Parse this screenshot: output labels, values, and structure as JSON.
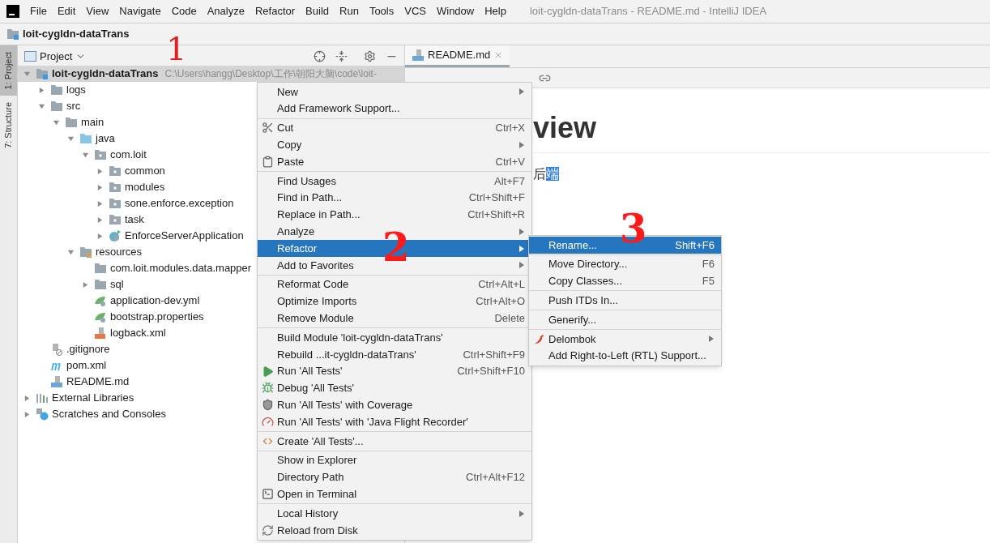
{
  "menu_bar": {
    "items": [
      "File",
      "Edit",
      "View",
      "Navigate",
      "Code",
      "Analyze",
      "Refactor",
      "Build",
      "Run",
      "Tools",
      "VCS",
      "Window",
      "Help"
    ],
    "title": "loit-cygldn-dataTrans - README.md - IntelliJ IDEA"
  },
  "nav_bar": {
    "project": "loit-cygldn-dataTrans"
  },
  "side_strip": [
    {
      "label": "1: Project",
      "selected": true
    },
    {
      "label": "7: Structure",
      "selected": false
    }
  ],
  "project_panel": {
    "title": "Project",
    "tree": [
      {
        "label": "loit-cygldn-dataTrans",
        "hint": "C:\\Users\\hangg\\Desktop\\工作\\朝阳大脑\\code\\loit-",
        "kind": "module",
        "expanded": true,
        "selected": true,
        "children": [
          {
            "label": "logs",
            "kind": "folder",
            "expanded": false
          },
          {
            "label": "src",
            "kind": "folder",
            "expanded": true,
            "children": [
              {
                "label": "main",
                "kind": "folder",
                "expanded": true,
                "children": [
                  {
                    "label": "java",
                    "kind": "source",
                    "expanded": true,
                    "children": [
                      {
                        "label": "com.loit",
                        "kind": "package",
                        "expanded": true,
                        "children": [
                          {
                            "label": "common",
                            "kind": "package",
                            "expanded": false
                          },
                          {
                            "label": "modules",
                            "kind": "package",
                            "expanded": false
                          },
                          {
                            "label": "sone.enforce.exception",
                            "kind": "package",
                            "expanded": false
                          },
                          {
                            "label": "task",
                            "kind": "package",
                            "expanded": false
                          },
                          {
                            "label": "EnforceServerApplication",
                            "kind": "springclass",
                            "expanded": false
                          }
                        ]
                      }
                    ]
                  },
                  {
                    "label": "resources",
                    "kind": "resources",
                    "expanded": true,
                    "children": [
                      {
                        "label": "com.loit.modules.data.mapper",
                        "kind": "folder"
                      },
                      {
                        "label": "sql",
                        "kind": "folder",
                        "expanded": false
                      },
                      {
                        "label": "application-dev.yml",
                        "kind": "springconfig"
                      },
                      {
                        "label": "bootstrap.properties",
                        "kind": "springconfig"
                      },
                      {
                        "label": "logback.xml",
                        "kind": "xml"
                      }
                    ]
                  }
                ]
              }
            ]
          },
          {
            "label": ".gitignore",
            "kind": "ignore"
          },
          {
            "label": "pom.xml",
            "kind": "maven"
          },
          {
            "label": "README.md",
            "kind": "markdown"
          }
        ]
      },
      {
        "label": "External Libraries",
        "kind": "libraries",
        "expanded": false
      },
      {
        "label": "Scratches and Consoles",
        "kind": "scratches",
        "expanded": false
      }
    ]
  },
  "editor": {
    "tab": "README.md",
    "heading": "view",
    "text": "后",
    "selected_text": "端"
  },
  "context_menu": [
    [
      {
        "label": "New",
        "submenu": true,
        "selected": false
      },
      {
        "label": "Add Framework Support...",
        "submenu": false,
        "selected": false
      }
    ],
    [
      {
        "label": "Cut",
        "shortcut": "Ctrl+X",
        "kind": "cut",
        "submenu": false,
        "selected": false
      },
      {
        "label": "Copy",
        "submenu": true,
        "selected": false
      },
      {
        "label": "Paste",
        "shortcut": "Ctrl+V",
        "kind": "paste",
        "submenu": false,
        "selected": false
      }
    ],
    [
      {
        "label": "Find Usages",
        "shortcut": "Alt+F7",
        "submenu": false,
        "selected": false
      },
      {
        "label": "Find in Path...",
        "shortcut": "Ctrl+Shift+F",
        "submenu": false,
        "selected": false
      },
      {
        "label": "Replace in Path...",
        "shortcut": "Ctrl+Shift+R",
        "submenu": false,
        "selected": false
      },
      {
        "label": "Analyze",
        "submenu": true,
        "selected": false
      },
      {
        "label": "Refactor",
        "submenu": true,
        "selected": true
      },
      {
        "label": "Add to Favorites",
        "submenu": true,
        "selected": false
      }
    ],
    [
      {
        "label": "Reformat Code",
        "shortcut": "Ctrl+Alt+L",
        "submenu": false,
        "selected": false
      },
      {
        "label": "Optimize Imports",
        "shortcut": "Ctrl+Alt+O",
        "submenu": false,
        "selected": false
      },
      {
        "label": "Remove Module",
        "shortcut": "Delete",
        "submenu": false,
        "selected": false
      }
    ],
    [
      {
        "label": "Build Module 'loit-cygldn-dataTrans'",
        "submenu": false,
        "selected": false
      },
      {
        "label": "Rebuild ...it-cygldn-dataTrans'",
        "shortcut": "Ctrl+Shift+F9",
        "submenu": false,
        "selected": false
      },
      {
        "label": "Run 'All Tests'",
        "shortcut": "Ctrl+Shift+F10",
        "kind": "run",
        "submenu": false,
        "selected": false
      },
      {
        "label": "Debug 'All Tests'",
        "kind": "debug",
        "submenu": false,
        "selected": false
      },
      {
        "label": "Run 'All Tests' with Coverage",
        "kind": "coverage",
        "submenu": false,
        "selected": false
      },
      {
        "label": "Run 'All Tests' with 'Java Flight Recorder'",
        "kind": "profiler",
        "submenu": false,
        "selected": false
      }
    ],
    [
      {
        "label": "Create 'All Tests'...",
        "kind": "create",
        "submenu": false,
        "selected": false
      }
    ],
    [
      {
        "label": "Show in Explorer",
        "submenu": false,
        "selected": false
      },
      {
        "label": "Directory Path",
        "shortcut": "Ctrl+Alt+F12",
        "submenu": false,
        "selected": false
      },
      {
        "label": "Open in Terminal",
        "kind": "terminal",
        "submenu": false,
        "selected": false
      }
    ],
    [
      {
        "label": "Local History",
        "submenu": true,
        "selected": false
      },
      {
        "label": "Reload from Disk",
        "kind": "reload",
        "submenu": false,
        "selected": false
      }
    ]
  ],
  "submenu": [
    [
      {
        "label": "Rename...",
        "shortcut": "Shift+F6",
        "submenu": false,
        "selected": true
      }
    ],
    [
      {
        "label": "Move Directory...",
        "shortcut": "F6",
        "submenu": false,
        "selected": false
      },
      {
        "label": "Copy Classes...",
        "shortcut": "F5",
        "submenu": false,
        "selected": false
      }
    ],
    [
      {
        "label": "Push ITDs In...",
        "submenu": false,
        "selected": false
      }
    ],
    [
      {
        "label": "Generify...",
        "submenu": false,
        "selected": false
      }
    ],
    [
      {
        "label": "Delombok",
        "submenu": true,
        "kind": "chili",
        "selected": false
      },
      {
        "label": "Add Right-to-Left (RTL) Support...",
        "submenu": false,
        "selected": false
      }
    ]
  ],
  "annotations": [
    "1",
    "2",
    "3"
  ]
}
